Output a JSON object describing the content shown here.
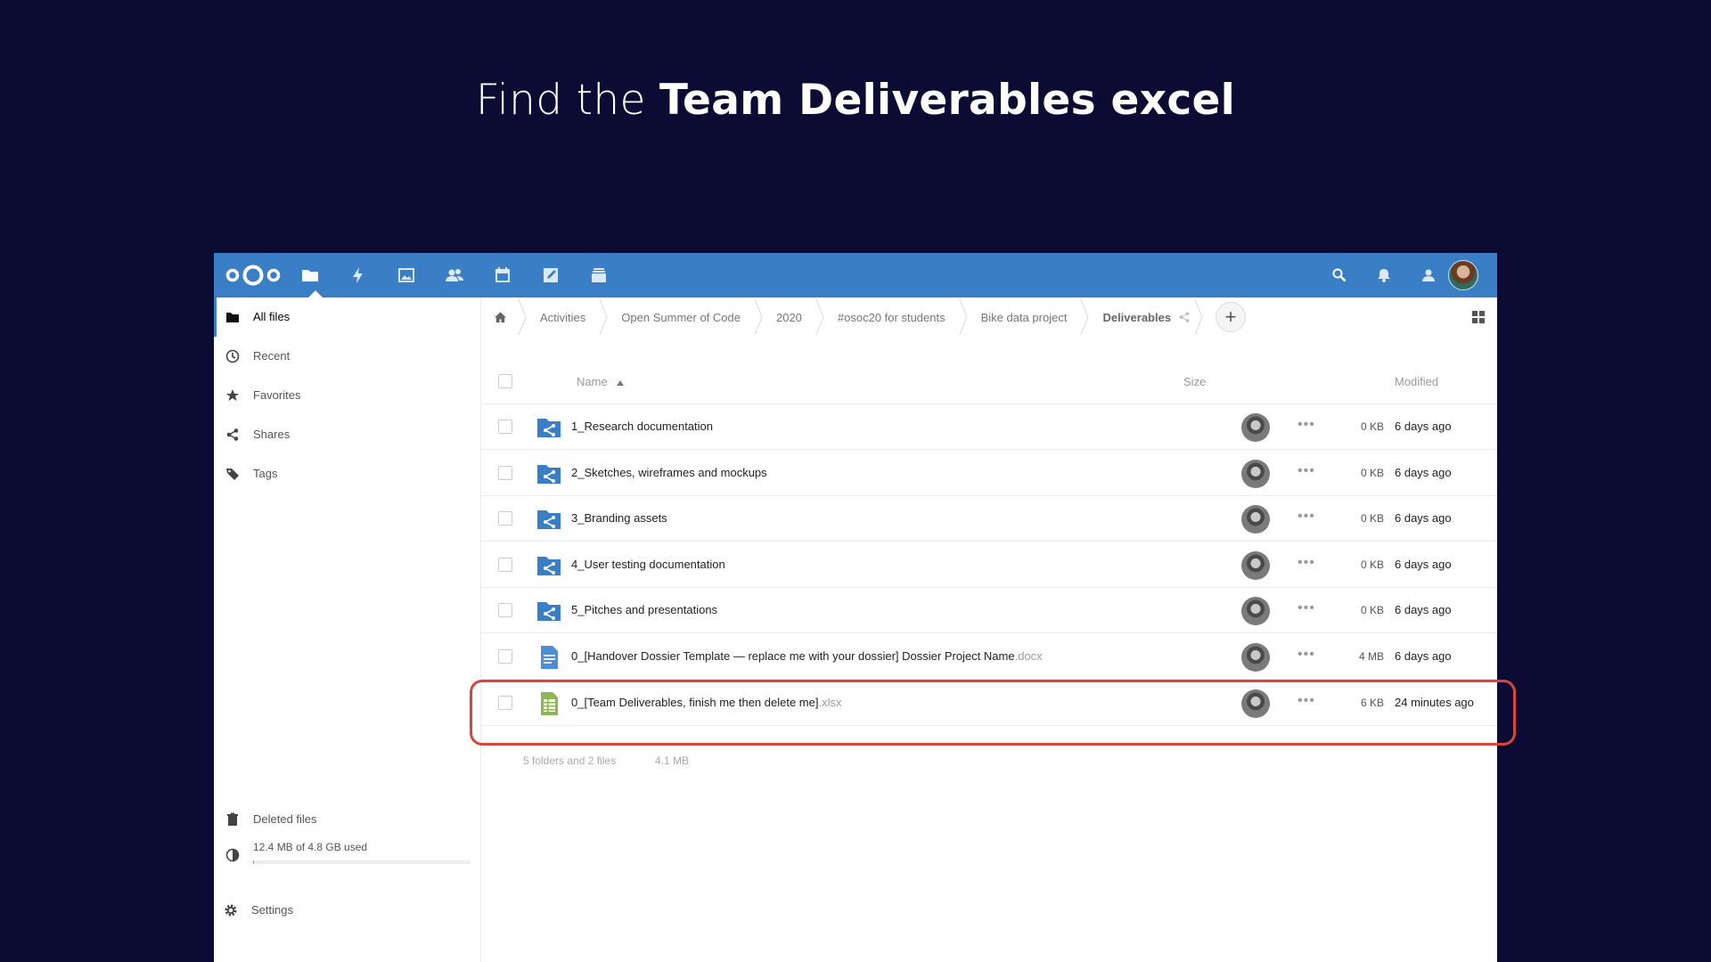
{
  "headline": {
    "prefix": "Find the ",
    "bold": "Team Deliverables excel"
  },
  "topbar": {
    "apps": [
      "files-icon",
      "activity-icon",
      "photos-icon",
      "contacts-icon",
      "calendar-icon",
      "notes-icon",
      "deck-icon"
    ],
    "right": [
      "search-icon",
      "notifications-icon",
      "contacts-menu-icon"
    ]
  },
  "sidebar": {
    "items": [
      {
        "label": "All files",
        "icon": "folder-icon"
      },
      {
        "label": "Recent",
        "icon": "clock-icon"
      },
      {
        "label": "Favorites",
        "icon": "star-icon"
      },
      {
        "label": "Shares",
        "icon": "share-icon"
      },
      {
        "label": "Tags",
        "icon": "tag-icon"
      }
    ],
    "deleted": "Deleted files",
    "quota": "12.4 MB of 4.8 GB used",
    "quota_fraction": 0.003,
    "settings": "Settings"
  },
  "breadcrumbs": [
    "Activities",
    "Open Summer of Code",
    "2020",
    "#osoc20 for students",
    "Bike data project",
    "Deliverables"
  ],
  "table": {
    "header": {
      "name": "Name",
      "size": "Size",
      "modified": "Modified"
    },
    "rows": [
      {
        "name": "1_Research documentation",
        "ext": "",
        "type": "shared-folder",
        "size": "0 KB",
        "modified": "6 days ago"
      },
      {
        "name": "2_Sketches, wireframes and mockups",
        "ext": "",
        "type": "shared-folder",
        "size": "0 KB",
        "modified": "6 days ago"
      },
      {
        "name": "3_Branding assets",
        "ext": "",
        "type": "shared-folder",
        "size": "0 KB",
        "modified": "6 days ago"
      },
      {
        "name": "4_User testing documentation",
        "ext": "",
        "type": "shared-folder",
        "size": "0 KB",
        "modified": "6 days ago"
      },
      {
        "name": "5_Pitches and presentations",
        "ext": "",
        "type": "shared-folder",
        "size": "0 KB",
        "modified": "6 days ago"
      },
      {
        "name": "0_[Handover Dossier Template — replace me with your dossier] Dossier Project Name",
        "ext": ".docx",
        "type": "document",
        "size": "4 MB",
        "modified": "6 days ago"
      },
      {
        "name": "0_[Team Deliverables, finish me then delete me]",
        "ext": ".xlsx",
        "type": "spreadsheet",
        "size": "6 KB",
        "modified": "24 minutes ago"
      }
    ],
    "summary_count": "5 folders and 2 files",
    "summary_size": "4.1 MB"
  },
  "colors": {
    "accent": "#3a7fc6",
    "highlight": "#d9453c",
    "background": "#0b0b33"
  }
}
